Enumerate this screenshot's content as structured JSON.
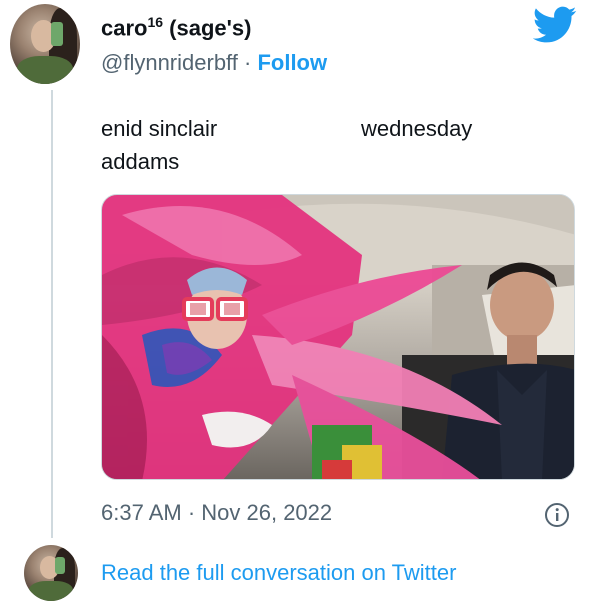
{
  "author": {
    "name": "caro",
    "name_sup": "16",
    "name_suffix": " (sage's)",
    "handle": "@flynnriderbff",
    "separator": " · ",
    "follow_label": "Follow"
  },
  "tweet": {
    "line1_left": "enid sinclair",
    "line1_right": "wednesday",
    "line2_left": "addams"
  },
  "meta": {
    "timestamp": "6:37 AM · Nov 26, 2022"
  },
  "footer": {
    "link_label": "Read the full conversation on Twitter"
  },
  "icons": {
    "brand": "twitter-bird-icon",
    "info": "info-icon"
  },
  "colors": {
    "accent": "#1d9bf0",
    "text": "#0f1419",
    "secondary": "#536471",
    "border": "#cfd9de"
  }
}
